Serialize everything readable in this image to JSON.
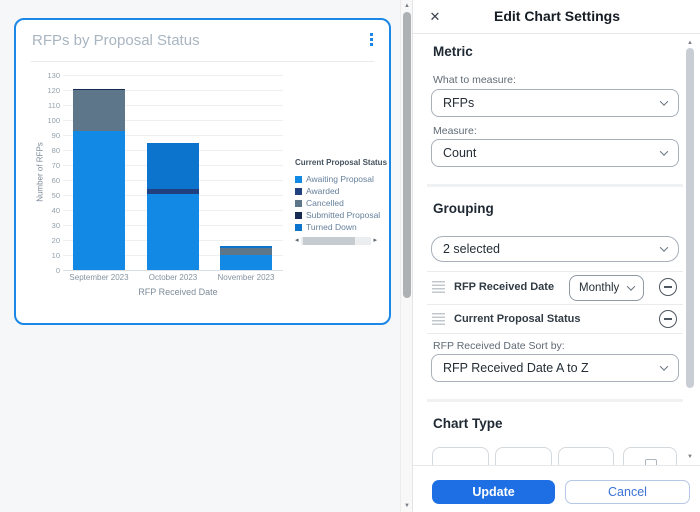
{
  "colors": {
    "accent": "#1B87E6",
    "update_button": "#1D6FE3"
  },
  "chart_card": {
    "title": "RFPs by Proposal Status",
    "menu_icon": "kebab-menu"
  },
  "chart_data": {
    "type": "bar",
    "stacked": true,
    "title": "RFPs by Proposal Status",
    "xlabel": "RFP Received Date",
    "ylabel": "Number of RFPs",
    "ylim": [
      0,
      130
    ],
    "ytick_step": 10,
    "grid": true,
    "legend_position": "right",
    "legend_title": "Current Proposal Status",
    "categories": [
      "September 2023",
      "October 2023",
      "November 2023"
    ],
    "series": [
      {
        "name": "Awaiting Proposal",
        "color": "#1389E6",
        "values": [
          93,
          51,
          10
        ]
      },
      {
        "name": "Awarded",
        "color": "#204080",
        "values": [
          0,
          3,
          0
        ]
      },
      {
        "name": "Cancelled",
        "color": "#5E7689",
        "values": [
          27,
          0,
          5
        ]
      },
      {
        "name": "Submitted Proposal",
        "color": "#182B52",
        "values": [
          1,
          0,
          0
        ]
      },
      {
        "name": "Turned Down",
        "color": "#0C74CC",
        "values": [
          0,
          31,
          1
        ]
      }
    ],
    "totals": [
      121,
      85,
      16
    ]
  },
  "panel": {
    "title": "Edit Chart Settings",
    "close_glyph": "✕",
    "metric": {
      "heading": "Metric",
      "what_label": "What to measure:",
      "what_value": "RFPs",
      "measure_label": "Measure:",
      "measure_value": "Count"
    },
    "grouping": {
      "heading": "Grouping",
      "selected_value": "2 selected",
      "rows": [
        {
          "label": "RFP Received Date",
          "dropdown": "Monthly"
        },
        {
          "label": "Current Proposal Status"
        }
      ],
      "sort_label": "RFP Received Date Sort by:",
      "sort_value": "RFP Received Date A to Z"
    },
    "chart_type": {
      "heading": "Chart Type"
    },
    "footer": {
      "update_label": "Update",
      "cancel_label": "Cancel"
    }
  }
}
